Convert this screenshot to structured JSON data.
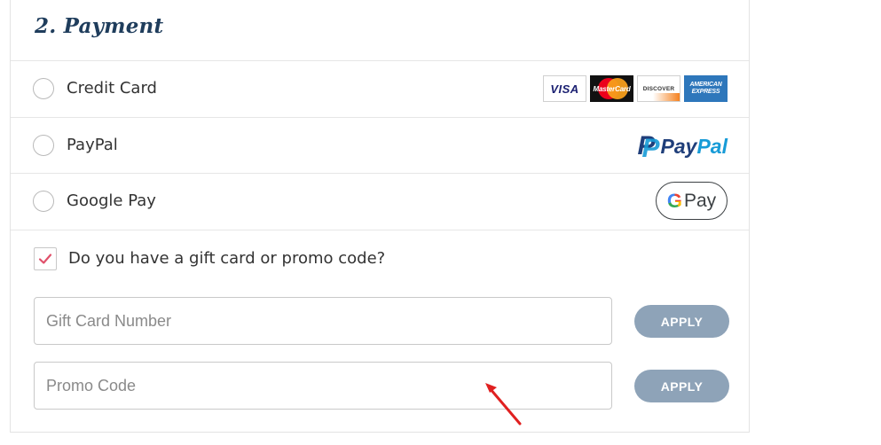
{
  "section": {
    "title": "2. Payment"
  },
  "payment_options": [
    {
      "label": "Credit Card",
      "selected": false
    },
    {
      "label": "PayPal",
      "selected": false
    },
    {
      "label": "Google Pay",
      "selected": false
    }
  ],
  "card_logos": {
    "visa": "VISA",
    "mastercard": "MasterCard",
    "discover": "DISCOVER",
    "amex_line1": "AMERICAN",
    "amex_line2": "EXPRESS"
  },
  "paypal_logo": {
    "mark": "P",
    "word1": "Pay",
    "word2": "Pal"
  },
  "gpay_logo": {
    "g": "G",
    "pay": "Pay"
  },
  "promo": {
    "checkbox_label": "Do you have a gift card or promo code?",
    "checked": true,
    "gift_card_placeholder": "Gift Card Number",
    "gift_card_value": "",
    "promo_placeholder": "Promo Code",
    "promo_value": "",
    "apply_label": "APPLY"
  },
  "colors": {
    "title": "#1f3d5c",
    "apply_button": "#8ea3b8",
    "checkmark": "#e0506a",
    "annotation_arrow": "#e02020"
  }
}
